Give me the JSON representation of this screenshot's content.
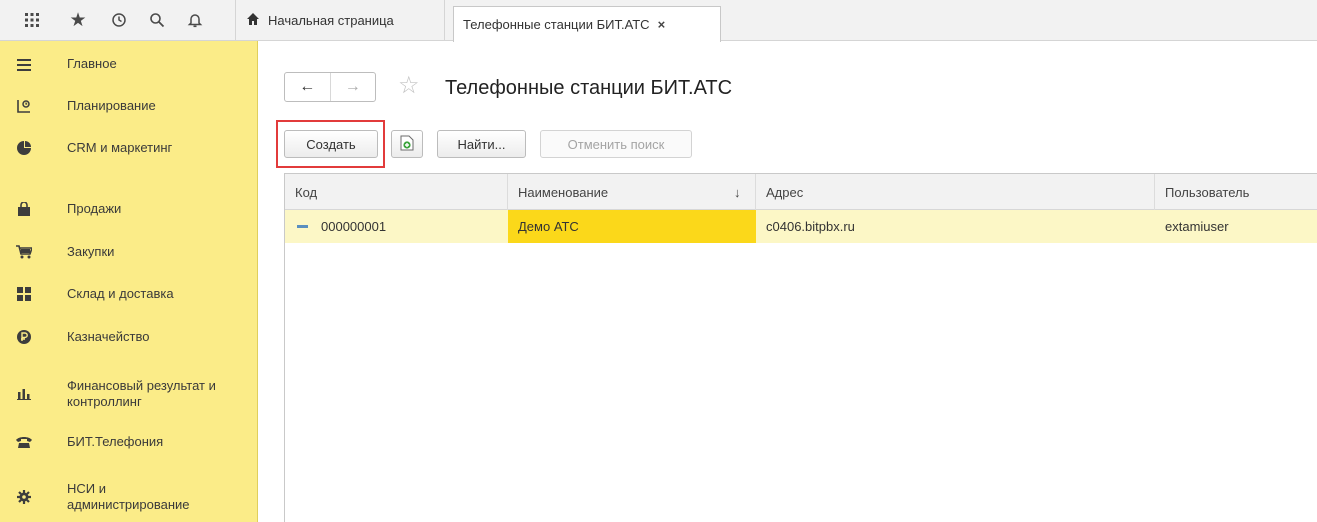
{
  "topbar": {
    "icons": [
      "apps-grid-icon",
      "star-icon",
      "history-icon",
      "search-icon",
      "bell-icon"
    ],
    "home_tab": {
      "icon": "home-icon",
      "label": "Начальная страница"
    },
    "active_tab": {
      "label": "Телефонные станции БИТ.АТС",
      "close": "×"
    }
  },
  "sidebar": {
    "items": [
      {
        "icon": "menu-icon",
        "label": "Главное"
      },
      {
        "icon": "planning-icon",
        "label": "Планирование"
      },
      {
        "icon": "pie-chart-icon",
        "label": "CRM и маркетинг"
      },
      {
        "icon": "shopping-bag-icon",
        "label": "Продажи"
      },
      {
        "icon": "cart-icon",
        "label": "Закупки"
      },
      {
        "icon": "warehouse-icon",
        "label": "Склад и доставка"
      },
      {
        "icon": "treasury-icon",
        "label": "Казначейство"
      },
      {
        "icon": "bar-chart-icon",
        "label": "Финансовый результат и\nконтроллинг"
      },
      {
        "icon": "phone-icon",
        "label": "БИТ.Телефония"
      },
      {
        "icon": "gear-icon",
        "label": "НСИ и\nадминистрирование"
      }
    ]
  },
  "main": {
    "title": "Телефонные станции БИТ.АТС",
    "nav": {
      "back": "←",
      "forward": "→"
    },
    "toolbar": {
      "create_label": "Создать",
      "find_label": "Найти...",
      "cancel_search_label": "Отменить поиск"
    },
    "grid": {
      "columns": [
        "Код",
        "Наименование",
        "Адрес",
        "Пользователь"
      ],
      "sort_indicator": "↓",
      "rows": [
        {
          "code": "000000001",
          "name": "Демо АТС",
          "address": "c0406.bitpbx.ru",
          "user": "extamiuser"
        }
      ]
    }
  },
  "colors": {
    "sidebar_bg": "#fbec88",
    "selected_row": "#fcf7c6",
    "selected_cell": "#fbd81a",
    "highlight_box": "#e23b3b"
  }
}
